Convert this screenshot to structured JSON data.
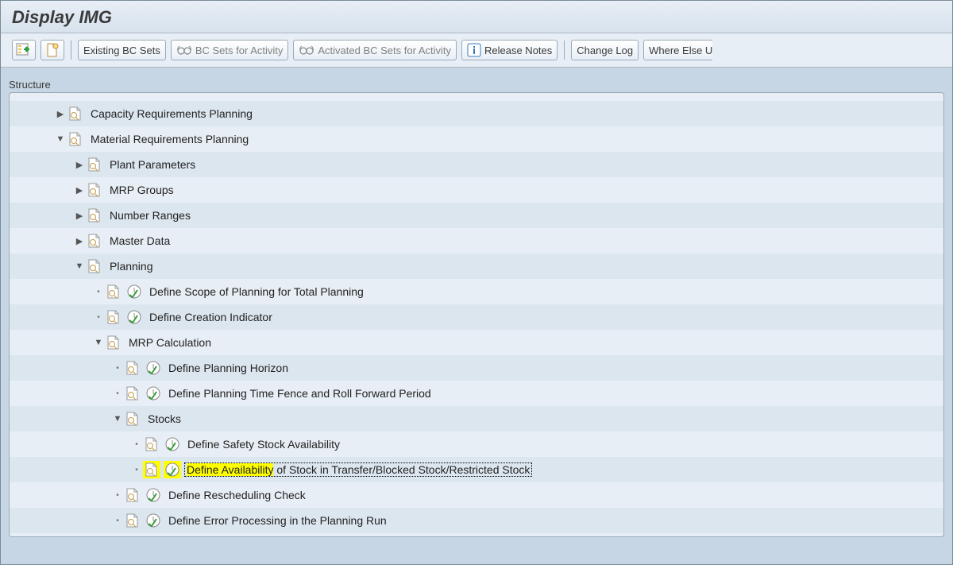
{
  "title": "Display IMG",
  "toolbar": {
    "existing_bc_sets": "Existing BC Sets",
    "bc_sets_activity": "BC Sets for Activity",
    "activated_bc_sets": "Activated BC Sets for Activity",
    "release_notes": "Release Notes",
    "change_log": "Change Log",
    "where_else": "Where Else U"
  },
  "section": "Structure",
  "tree": {
    "r0": "Capacity Requirements Planning",
    "r1": "Material Requirements Planning",
    "r2": "Plant Parameters",
    "r3": "MRP Groups",
    "r4": "Number Ranges",
    "r5": "Master Data",
    "r6": "Planning",
    "r7": "Define Scope of Planning for Total Planning",
    "r8": "Define Creation Indicator",
    "r9": "MRP Calculation",
    "r10a": "Define Planning Horizon",
    "r10b": "Define Planning Time Fence and Roll Forward Period",
    "r11": "Stocks",
    "r12": "Define Safety Stock Availability",
    "r13a": "Define Availability",
    "r13b": " of Stock in Transfer/Blocked Stock/Restricted Stock",
    "r14": "Define Rescheduling Check",
    "r15": "Define Error Processing in the Planning Run"
  }
}
